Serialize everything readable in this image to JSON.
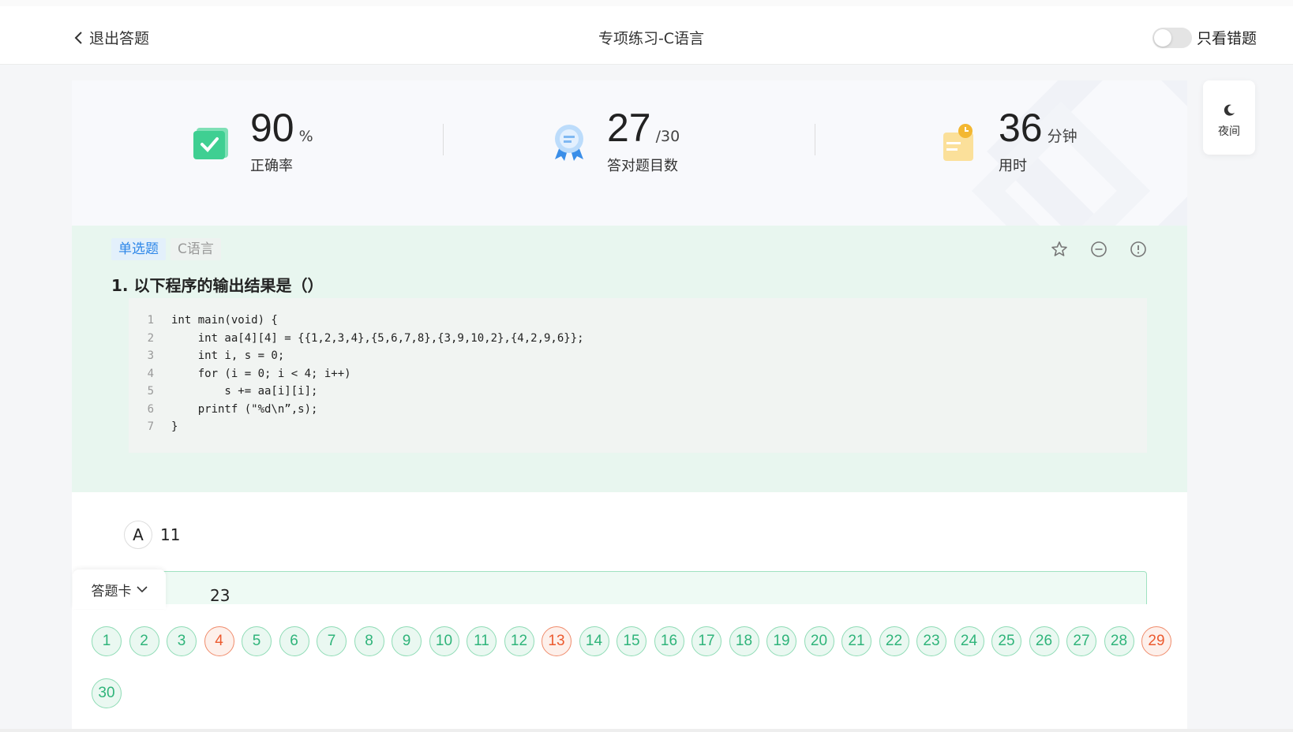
{
  "header": {
    "back_label": "退出答题",
    "title": "专项练习-C语言",
    "toggle_label": "只看错题"
  },
  "stats": [
    {
      "value": "90",
      "unit": "%",
      "label": "正确率",
      "icon": "check-book-icon",
      "color": "#4fd39b"
    },
    {
      "value": "27",
      "unit": "/30",
      "label": "答对题目数",
      "icon": "award-medal-icon",
      "color": "#5aa8f0"
    },
    {
      "value": "36",
      "unit": "分钟",
      "label": "用时",
      "icon": "clock-note-icon",
      "color": "#f5c34b"
    }
  ],
  "question": {
    "type_tag": "单选题",
    "lang_tag": "C语言",
    "title": "1. 以下程序的输出结果是（）",
    "code": [
      {
        "n": "1",
        "t": "int main(void) {"
      },
      {
        "n": "2",
        "t": "    int aa[4][4] = {{1,2,3,4},{5,6,7,8},{3,9,10,2},{4,2,9,6}};"
      },
      {
        "n": "3",
        "t": "    int i, s = 0;"
      },
      {
        "n": "4",
        "t": "    for (i = 0; i < 4; i++)"
      },
      {
        "n": "5",
        "t": "        s += aa[i][i];"
      },
      {
        "n": "6",
        "t": "    printf (\"%d\\n”,s);"
      },
      {
        "n": "7",
        "t": "}"
      }
    ]
  },
  "options": {
    "a_letter": "A",
    "a_text": "11",
    "b_text": "23"
  },
  "sheet": {
    "tab_label": "答题卡",
    "numbers": [
      {
        "n": "1"
      },
      {
        "n": "2"
      },
      {
        "n": "3"
      },
      {
        "n": "4",
        "wrong": true
      },
      {
        "n": "5"
      },
      {
        "n": "6"
      },
      {
        "n": "7"
      },
      {
        "n": "8"
      },
      {
        "n": "9"
      },
      {
        "n": "10"
      },
      {
        "n": "11"
      },
      {
        "n": "12"
      },
      {
        "n": "13",
        "wrong": true
      },
      {
        "n": "14"
      },
      {
        "n": "15"
      },
      {
        "n": "16"
      },
      {
        "n": "17"
      },
      {
        "n": "18"
      },
      {
        "n": "19"
      },
      {
        "n": "20"
      },
      {
        "n": "21"
      },
      {
        "n": "22"
      },
      {
        "n": "23"
      },
      {
        "n": "24"
      },
      {
        "n": "25"
      },
      {
        "n": "26"
      },
      {
        "n": "27"
      },
      {
        "n": "28"
      },
      {
        "n": "29",
        "wrong": true
      },
      {
        "n": "30"
      }
    ]
  },
  "night": {
    "label": "夜间"
  }
}
